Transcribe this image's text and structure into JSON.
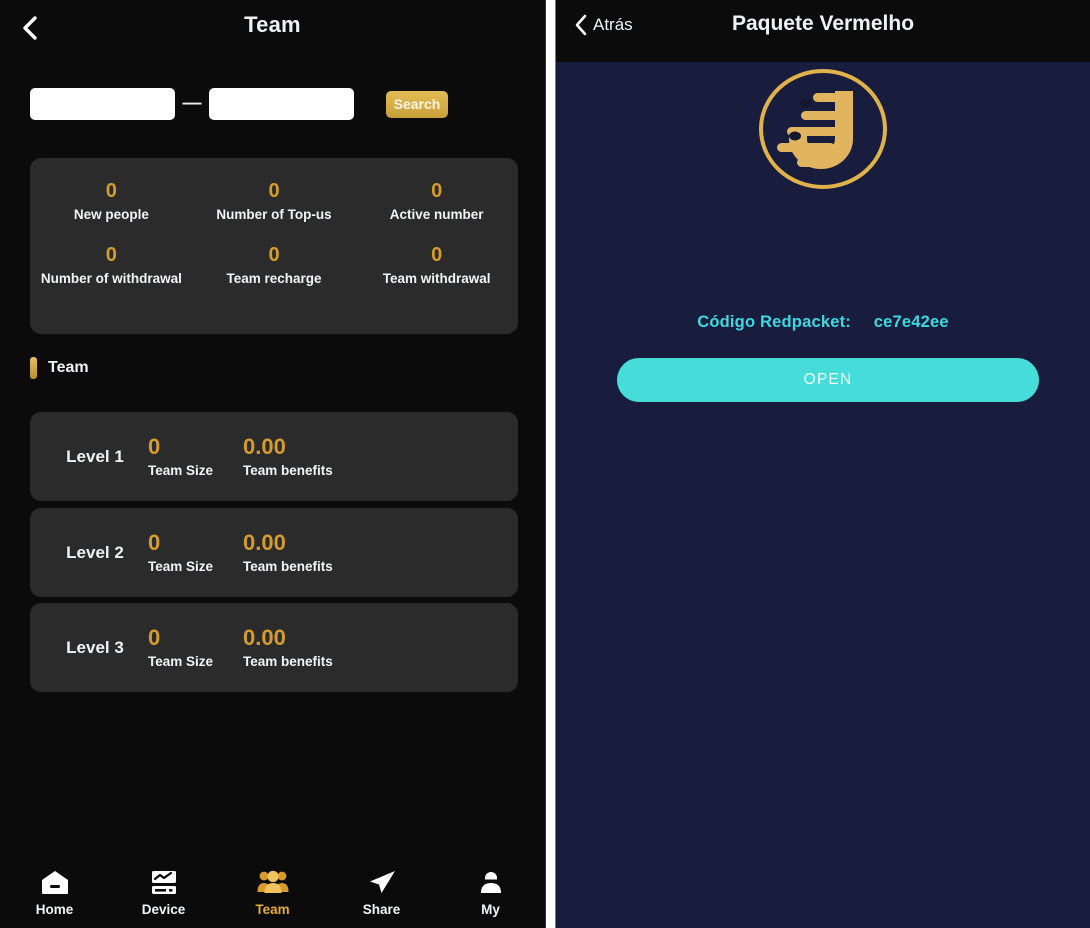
{
  "left": {
    "header": {
      "back_icon": "chevron-left-icon",
      "title": "Team"
    },
    "search": {
      "field_start_value": "",
      "field_start_placeholder": "",
      "separator": "—",
      "field_end_value": "",
      "field_end_placeholder": "",
      "button_label": "Search"
    },
    "stats": [
      {
        "value": "0",
        "label": "New people"
      },
      {
        "value": "0",
        "label": "Number of Top-us"
      },
      {
        "value": "0",
        "label": "Active number"
      },
      {
        "value": "0",
        "label": "Number of withdrawal"
      },
      {
        "value": "0",
        "label": "Team recharge"
      },
      {
        "value": "0",
        "label": "Team withdrawal"
      }
    ],
    "section": {
      "title": "Team"
    },
    "levels": [
      {
        "name": "Level 1",
        "size_value": "0",
        "size_label": "Team Size",
        "profit_value": "0.00",
        "profit_label": "Team benefits"
      },
      {
        "name": "Level 2",
        "size_value": "0",
        "size_label": "Team Size",
        "profit_value": "0.00",
        "profit_label": "Team benefits"
      },
      {
        "name": "Level 3",
        "size_value": "0",
        "size_label": "Team Size",
        "profit_value": "0.00",
        "profit_label": "Team benefits"
      }
    ],
    "bottom_nav": [
      {
        "icon": "home-icon",
        "label": "Home",
        "active": false
      },
      {
        "icon": "device-icon",
        "label": "Device",
        "active": false
      },
      {
        "icon": "team-icon",
        "label": "Team",
        "active": true
      },
      {
        "icon": "share-icon",
        "label": "Share",
        "active": false
      },
      {
        "icon": "user-icon",
        "label": "My",
        "active": false
      }
    ]
  },
  "right": {
    "header": {
      "back_icon": "chevron-left-icon",
      "back_label": "Atrás",
      "title": "Paquete Vermelho"
    },
    "logo": {
      "name": "brand-u-logo"
    },
    "code": {
      "label": "Código Redpacket:",
      "value": "ce7e42ee"
    },
    "open_button_label": "OPEN"
  },
  "colors": {
    "page_black": "#0b0b0b",
    "card_gray": "#2b2b2b",
    "gold": "#d69b2d",
    "gold_light": "#e3ae33",
    "navy": "#191d3d",
    "cyan": "#45dcd9",
    "cyan_text": "#3fd8e0",
    "white_text": "#eef2f6"
  }
}
